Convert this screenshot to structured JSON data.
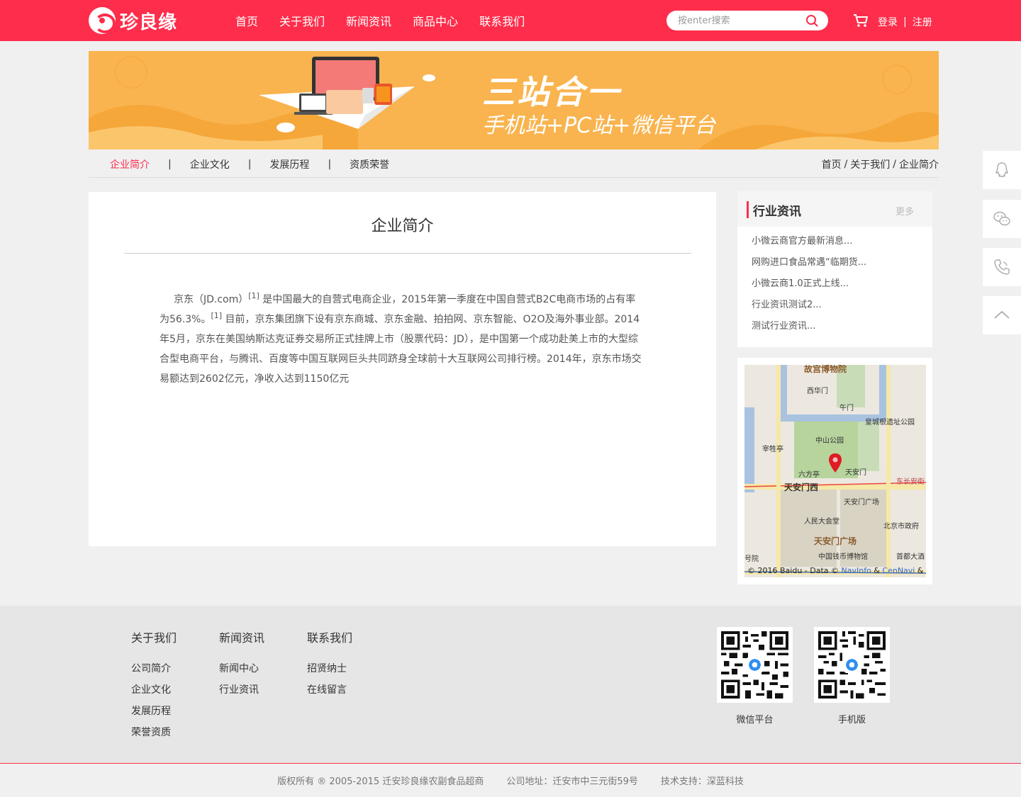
{
  "header": {
    "logo_text": "珍良缘",
    "nav": [
      "首页",
      "关于我们",
      "新闻资讯",
      "商品中心",
      "联系我们"
    ],
    "search_placeholder": "按enter搜索",
    "login": "登录",
    "divider": "|",
    "register": "注册"
  },
  "banner": {
    "headline": "三站合一",
    "subline": "手机站+PC站+微信平台"
  },
  "subnav": {
    "tabs": [
      "企业简介",
      "企业文化",
      "发展历程",
      "资质荣誉"
    ],
    "separator": "|",
    "breadcrumb": [
      "首页",
      "关于我们",
      "企业简介"
    ],
    "breadcrumb_sep": "/"
  },
  "article": {
    "title": "企业简介",
    "p1": "京东（JD.com）",
    "ref1": "[1]",
    "p2": " 是中国最大的自营式电商企业，2015年第一季度在中国自营式B2C电商市场的占有率为56.3%。",
    "ref2": "[1]",
    "p3": " 目前，京东集团旗下设有京东商城、京东金融、拍拍网、京东智能、O2O及海外事业部。2014年5月，京东在美国纳斯达克证券交易所正式挂牌上市（股票代码：JD），是中国第一个成功赴美上市的大型综合型电商平台，与腾讯、百度等中国互联网巨头共同跻身全球前十大互联网公司排行榜。2014年，京东市场交易额达到2602亿元，净收入达到1150亿元"
  },
  "sidebar": {
    "title": "行业资讯",
    "more": "更多",
    "items": [
      "小微云商官方最新消息...",
      "网购进口食品常遇“临期货...",
      "小微云商1.0正式上线...",
      "行业资讯测试2...",
      "测试行业资讯..."
    ]
  },
  "map": {
    "labels": [
      "故宫博物院",
      "西华门",
      "午门",
      "皇城根遗址公园",
      "中山公园",
      "宰牲亭",
      "六方亭",
      "天安门",
      "天安门西",
      "东长安街",
      "天安门广场",
      "人民大会堂",
      "北京市政府",
      "天安门广场",
      "中国钱币博物馆",
      "首都大酒",
      "号院"
    ],
    "copyright_prefix": "© 2016 Baidu - Data © ",
    "link1": "NavInfo",
    "amp": " & ",
    "link2": "CenNavi",
    "tail": " & 道"
  },
  "footer": {
    "cols": [
      {
        "title": "关于我们",
        "items": [
          "公司简介",
          "企业文化",
          "发展历程",
          "荣誉资质"
        ]
      },
      {
        "title": "新闻资讯",
        "items": [
          "新闻中心",
          "行业资讯"
        ]
      },
      {
        "title": "联系我们",
        "items": [
          "招贤纳士",
          "在线留言"
        ]
      }
    ],
    "qr_captions": [
      "微信平台",
      "手机版"
    ],
    "copyright": "版权所有 ® 2005-2015 迁安珍良缘农副食品超商",
    "address": "公司地址：迁安市中三元街59号",
    "support": "技术支持：深蓝科技"
  },
  "colors": {
    "brand": "#fd2d4b",
    "banner": "#f9b44f"
  }
}
